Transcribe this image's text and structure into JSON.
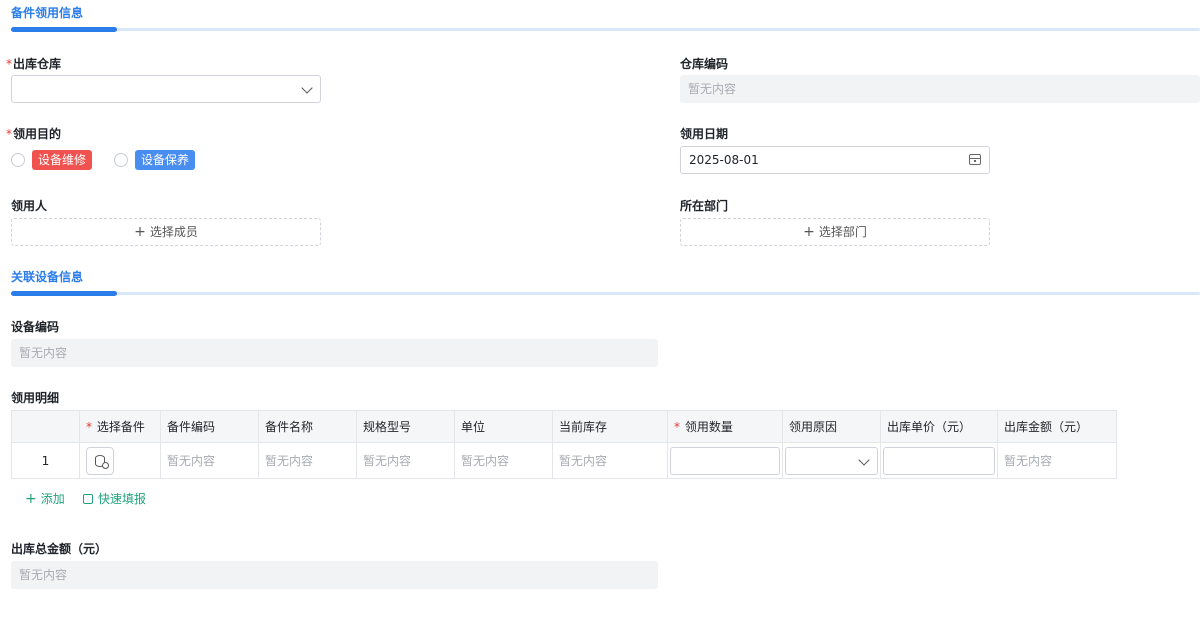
{
  "section1": {
    "title": "备件领用信息"
  },
  "warehouse": {
    "label": "出库仓库",
    "required_mark": "*",
    "value": ""
  },
  "warehouse_code": {
    "label": "仓库编码",
    "value": "暂无内容"
  },
  "purpose": {
    "label": "领用目的",
    "required_mark": "*",
    "options": [
      {
        "label": "设备维修",
        "color": "#f0524f"
      },
      {
        "label": "设备保养",
        "color": "#4a8df0"
      }
    ]
  },
  "date": {
    "label": "领用日期",
    "value": "2025-08-01"
  },
  "recipient": {
    "label": "领用人",
    "button": "选择成员",
    "plus": "+"
  },
  "department": {
    "label": "所在部门",
    "button": "选择部门",
    "plus": "+"
  },
  "section2": {
    "title": "关联设备信息"
  },
  "equipment_code": {
    "label": "设备编码",
    "value": "暂无内容"
  },
  "details": {
    "label": "领用明细",
    "columns": [
      {
        "label": "",
        "required": false
      },
      {
        "label": "选择备件",
        "required": true
      },
      {
        "label": "备件编码",
        "required": false
      },
      {
        "label": "备件名称",
        "required": false
      },
      {
        "label": "规格型号",
        "required": false
      },
      {
        "label": "单位",
        "required": false
      },
      {
        "label": "当前库存",
        "required": false
      },
      {
        "label": "领用数量",
        "required": true
      },
      {
        "label": "领用原因",
        "required": false
      },
      {
        "label": "出库单价（元）",
        "required": false
      },
      {
        "label": "出库金额（元）",
        "required": false
      }
    ],
    "required_mark": "*",
    "row": {
      "index": "1",
      "part_code": "暂无内容",
      "part_name": "暂无内容",
      "spec": "暂无内容",
      "unit": "暂无内容",
      "stock": "暂无内容",
      "amount": "暂无内容"
    },
    "add_label": "添加",
    "add_plus": "+",
    "quick_fill_label": "快速填报"
  },
  "total": {
    "label": "出库总金额（元）",
    "value": "暂无内容"
  },
  "colors": {
    "accent": "#2b7de9",
    "required": "#e33c39",
    "action": "#20a37a"
  }
}
